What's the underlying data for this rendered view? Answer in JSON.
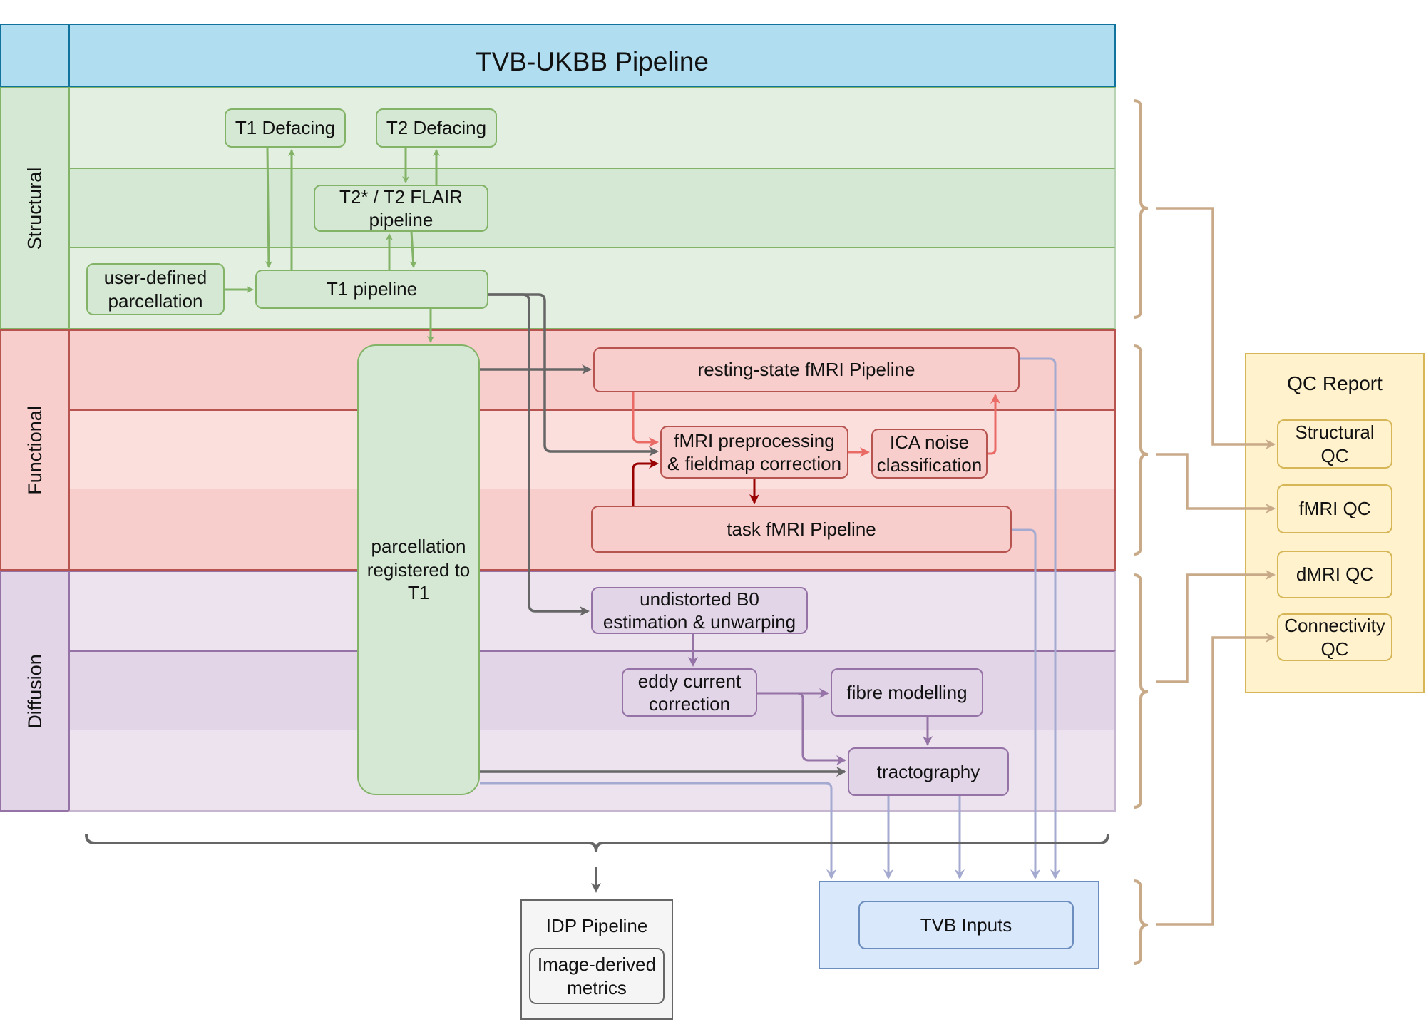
{
  "title": "TVB-UKBB Pipeline",
  "lanes": {
    "structural": "Structural",
    "functional": "Functional",
    "diffusion": "Diffusion"
  },
  "nodes": {
    "t1_defacing": "T1 Defacing",
    "t2_defacing": "T2 Defacing",
    "t2_flair": "T2* / T2 FLAIR\npipeline",
    "user_parcellation": "user-defined\nparcellation",
    "t1_pipeline": "T1 pipeline",
    "parcellation_registered": "parcellation\nregistered to\nT1",
    "resting_state": "resting-state fMRI Pipeline",
    "fmri_preprocessing": "fMRI preprocessing\n& fieldmap correction",
    "ica_noise": "ICA noise\nclassification",
    "task_fmri": "task fMRI Pipeline",
    "undistorted_b0": "undistorted B0\nestimation & unwarping",
    "eddy": "eddy current\ncorrection",
    "fibre": "fibre modelling",
    "tractography": "tractography"
  },
  "idp": {
    "title": "IDP Pipeline",
    "item": "Image-derived\nmetrics"
  },
  "tvb": {
    "item": "TVB Inputs"
  },
  "qc": {
    "title": "QC Report",
    "items": [
      "Structural\nQC",
      "fMRI QC",
      "dMRI QC",
      "Connectivity\nQC"
    ]
  },
  "colors": {
    "header": "#b1ddf0",
    "structural": "#d5e8d4",
    "functional": "#f8cecc",
    "diffusion": "#e1d5e7",
    "qc": "#fff2cc",
    "tvb": "#dae8fc",
    "idp": "#f5f5f5",
    "gray_arrow": "#666666",
    "tvb_arrow": "#a4aad0",
    "qc_arrow": "#c8aa88"
  }
}
